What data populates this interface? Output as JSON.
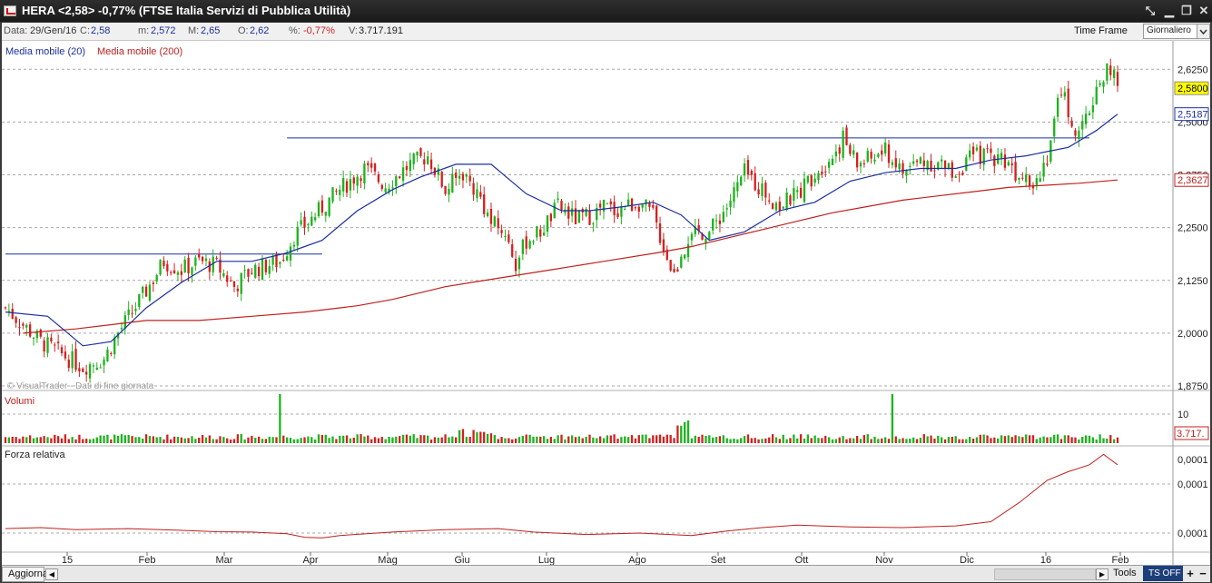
{
  "window": {
    "title": "HERA <2,58> -0,77%  (FTSE Italia Servizi di Pubblica Utilità)",
    "buttons": [
      "⤡",
      "▁",
      "❐",
      "✕"
    ]
  },
  "info": {
    "date_label": "Data:",
    "date": "29/Gen/16",
    "close_label": "C:",
    "close": "2,58",
    "min_label": "m:",
    "min": "2,572",
    "max_label": "M:",
    "max": "2,65",
    "open_label": "O:",
    "open": "2,62",
    "pct_label": "%:",
    "pct": "-0,77%",
    "vol_label": "V:",
    "vol": "3.717.191",
    "timeframe_label": "Time Frame",
    "timeframe_value": "Giornaliero"
  },
  "legend": {
    "ma20": "Media mobile (20)",
    "ma200": "Media mobile (200)",
    "ma20_color": "#1a2ea0",
    "ma200_color": "#c0201e",
    "watermark": "© VisualTrader - Dati di fine giornata"
  },
  "volume_panel": {
    "title": "Volumi",
    "tick": "10",
    "last": "3.717."
  },
  "rs_panel": {
    "title": "Forza relativa",
    "ticks": [
      "0,0001",
      "0,0001",
      "0,0001"
    ]
  },
  "status": {
    "refresh": "Aggiorna",
    "tools": "Tools",
    "ts": "TS OFF",
    "plus": "+",
    "minus": "−"
  },
  "chart_data": {
    "type": "candlestick",
    "price_ticks": [
      "2,6250",
      "2,5000",
      "2,3750",
      "2,2500",
      "2,1250",
      "2,0000",
      "1,8750"
    ],
    "ylim": [
      1.875,
      2.675
    ],
    "x_labels": [
      "15",
      "Feb",
      "Mar",
      "Apr",
      "Mag",
      "Giu",
      "Lug",
      "Ago",
      "Set",
      "Ott",
      "Nov",
      "Dic",
      "16",
      "Feb"
    ],
    "last_price": "2,5800",
    "ma20_last": "2,5187",
    "ma200_last": "2,3627",
    "up_color": "#1db31d",
    "down_color": "#d42020",
    "close_path": [
      [
        0,
        2.06
      ],
      [
        10,
        1.98
      ],
      [
        22,
        1.92
      ],
      [
        28,
        1.94
      ],
      [
        32,
        2.0
      ],
      [
        40,
        2.1
      ],
      [
        45,
        2.17
      ],
      [
        50,
        2.15
      ],
      [
        55,
        2.17
      ],
      [
        60,
        2.16
      ],
      [
        65,
        2.11
      ],
      [
        70,
        2.15
      ],
      [
        78,
        2.17
      ],
      [
        82,
        2.23
      ],
      [
        88,
        2.28
      ],
      [
        95,
        2.34
      ],
      [
        102,
        2.39
      ],
      [
        108,
        2.35
      ],
      [
        115,
        2.4
      ],
      [
        120,
        2.42
      ],
      [
        125,
        2.34
      ],
      [
        130,
        2.38
      ],
      [
        135,
        2.32
      ],
      [
        138,
        2.26
      ],
      [
        142,
        2.24
      ],
      [
        145,
        2.16
      ],
      [
        148,
        2.22
      ],
      [
        152,
        2.24
      ],
      [
        157,
        2.3
      ],
      [
        162,
        2.27
      ],
      [
        167,
        2.28
      ],
      [
        170,
        2.3
      ],
      [
        173,
        2.29
      ],
      [
        176,
        2.3
      ],
      [
        180,
        2.31
      ],
      [
        184,
        2.28
      ],
      [
        188,
        2.18
      ],
      [
        190,
        2.14
      ],
      [
        193,
        2.2
      ],
      [
        197,
        2.24
      ],
      [
        200,
        2.24
      ],
      [
        205,
        2.3
      ],
      [
        210,
        2.38
      ],
      [
        215,
        2.34
      ],
      [
        220,
        2.3
      ],
      [
        225,
        2.33
      ],
      [
        230,
        2.38
      ],
      [
        235,
        2.42
      ],
      [
        238,
        2.46
      ],
      [
        242,
        2.4
      ],
      [
        245,
        2.41
      ],
      [
        250,
        2.43
      ],
      [
        255,
        2.38
      ],
      [
        260,
        2.41
      ],
      [
        265,
        2.4
      ],
      [
        270,
        2.38
      ],
      [
        275,
        2.42
      ],
      [
        280,
        2.42
      ],
      [
        285,
        2.41
      ],
      [
        287,
        2.38
      ],
      [
        290,
        2.39
      ],
      [
        292,
        2.35
      ],
      [
        296,
        2.42
      ],
      [
        300,
        2.58
      ],
      [
        303,
        2.5
      ],
      [
        305,
        2.46
      ],
      [
        308,
        2.53
      ],
      [
        311,
        2.6
      ],
      [
        314,
        2.63
      ],
      [
        316,
        2.58
      ]
    ],
    "ma20_points": [
      [
        0,
        2.05
      ],
      [
        12,
        2.04
      ],
      [
        22,
        1.97
      ],
      [
        30,
        1.98
      ],
      [
        40,
        2.06
      ],
      [
        50,
        2.12
      ],
      [
        60,
        2.17
      ],
      [
        70,
        2.17
      ],
      [
        80,
        2.19
      ],
      [
        90,
        2.22
      ],
      [
        100,
        2.29
      ],
      [
        110,
        2.34
      ],
      [
        118,
        2.37
      ],
      [
        128,
        2.4
      ],
      [
        138,
        2.4
      ],
      [
        148,
        2.33
      ],
      [
        158,
        2.29
      ],
      [
        166,
        2.29
      ],
      [
        176,
        2.3
      ],
      [
        184,
        2.31
      ],
      [
        192,
        2.28
      ],
      [
        200,
        2.22
      ],
      [
        210,
        2.24
      ],
      [
        220,
        2.29
      ],
      [
        230,
        2.31
      ],
      [
        240,
        2.36
      ],
      [
        250,
        2.38
      ],
      [
        260,
        2.39
      ],
      [
        270,
        2.39
      ],
      [
        280,
        2.41
      ],
      [
        290,
        2.42
      ],
      [
        296,
        2.43
      ],
      [
        302,
        2.44
      ],
      [
        306,
        2.46
      ],
      [
        310,
        2.48
      ],
      [
        316,
        2.51876
      ]
    ],
    "ma200_points": [
      [
        5,
        2.0
      ],
      [
        20,
        2.01
      ],
      [
        40,
        2.03
      ],
      [
        55,
        2.03
      ],
      [
        70,
        2.04
      ],
      [
        85,
        2.05
      ],
      [
        100,
        2.065
      ],
      [
        110,
        2.08
      ],
      [
        125,
        2.11
      ],
      [
        140,
        2.13
      ],
      [
        155,
        2.15
      ],
      [
        170,
        2.17
      ],
      [
        185,
        2.19
      ],
      [
        195,
        2.205
      ],
      [
        205,
        2.225
      ],
      [
        215,
        2.245
      ],
      [
        225,
        2.265
      ],
      [
        235,
        2.285
      ],
      [
        245,
        2.3
      ],
      [
        255,
        2.315
      ],
      [
        265,
        2.325
      ],
      [
        275,
        2.335
      ],
      [
        285,
        2.345
      ],
      [
        295,
        2.35
      ],
      [
        305,
        2.355
      ],
      [
        316,
        2.3627
      ]
    ],
    "support_lines": [
      {
        "x1": 0,
        "x2": 90,
        "y": 2.1875
      },
      {
        "x1": 80,
        "x2": 308,
        "y": 2.4625
      }
    ],
    "volume_spikes": [
      [
        78,
        60
      ],
      [
        252,
        60
      ]
    ],
    "rs_points": [
      [
        0,
        0.55
      ],
      [
        10,
        0.58
      ],
      [
        20,
        0.52
      ],
      [
        35,
        0.55
      ],
      [
        50,
        0.5
      ],
      [
        60,
        0.46
      ],
      [
        70,
        0.45
      ],
      [
        80,
        0.4
      ],
      [
        85,
        0.3
      ],
      [
        90,
        0.28
      ],
      [
        95,
        0.35
      ],
      [
        110,
        0.45
      ],
      [
        125,
        0.52
      ],
      [
        140,
        0.55
      ],
      [
        150,
        0.45
      ],
      [
        165,
        0.38
      ],
      [
        180,
        0.42
      ],
      [
        195,
        0.35
      ],
      [
        205,
        0.48
      ],
      [
        215,
        0.58
      ],
      [
        225,
        0.65
      ],
      [
        240,
        0.6
      ],
      [
        255,
        0.58
      ],
      [
        270,
        0.63
      ],
      [
        280,
        0.75
      ],
      [
        288,
        1.3
      ],
      [
        296,
        1.95
      ],
      [
        302,
        2.2
      ],
      [
        308,
        2.4
      ],
      [
        312,
        2.7
      ],
      [
        316,
        2.4
      ]
    ],
    "n_bars": 317
  }
}
